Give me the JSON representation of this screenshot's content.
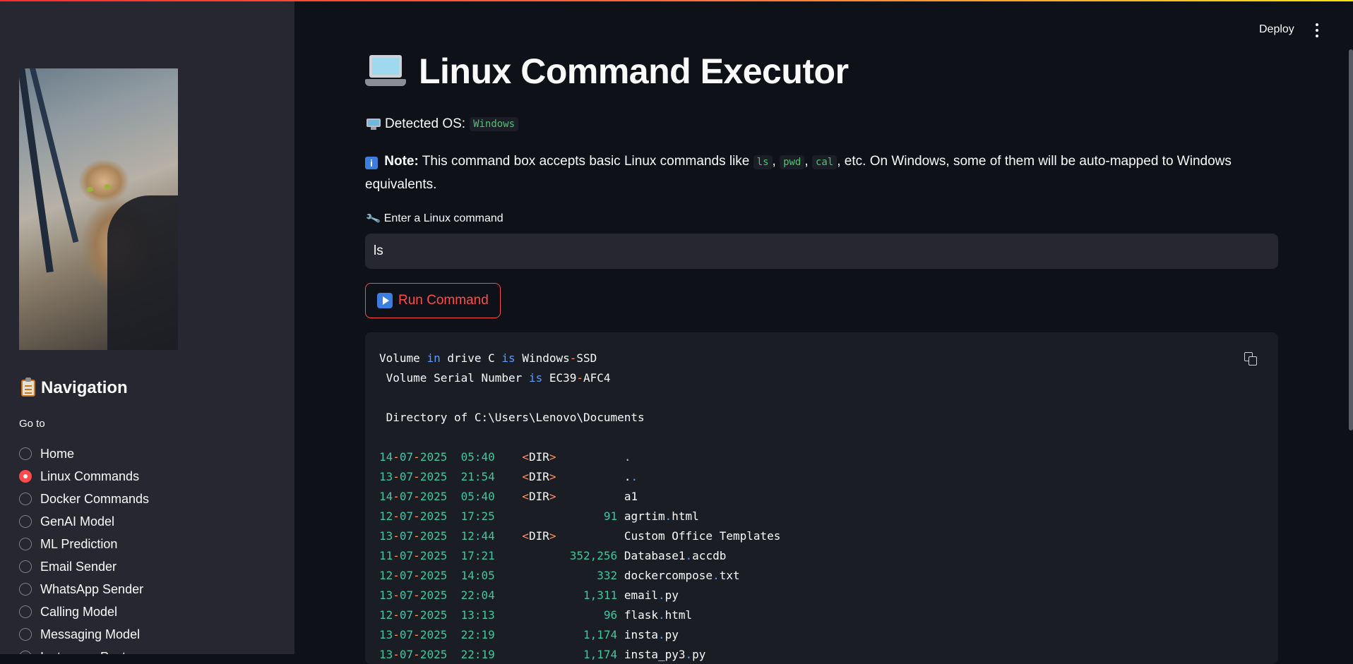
{
  "header": {
    "deploy_label": "Deploy"
  },
  "sidebar": {
    "nav_title": "Navigation",
    "goto_label": "Go to",
    "options": [
      "Home",
      "Linux Commands",
      "Docker Commands",
      "GenAI Model",
      "ML Prediction",
      "Email Sender",
      "WhatsApp Sender",
      "Calling Model",
      "Messaging Model",
      "Instagram Post"
    ],
    "selected": "Linux Commands"
  },
  "main": {
    "title": "Linux Command Executor",
    "os_label": "Detected OS:",
    "os_value": "Windows",
    "note_label": "Note:",
    "note_text_1": "This command box accepts basic Linux commands like",
    "note_cmd_1": "ls",
    "note_cmd_2": "pwd",
    "note_cmd_3": "cal",
    "note_text_2": ", etc. On Windows, some of them will be auto-mapped to Windows equivalents.",
    "input_label": "Enter a Linux command",
    "input_value": "ls",
    "run_label": "Run Command"
  },
  "output": {
    "volume_line": {
      "w1": "Volume",
      "w2": "in",
      "w3": "drive C",
      "w4": "is",
      "w5": "Windows",
      "w6": "-",
      "w7": "SSD"
    },
    "serial_line": {
      "w1": " Volume Serial Number",
      "w2": "is",
      "w3": "EC39",
      "w4": "-",
      "w5": "AFC4"
    },
    "directory_line": " Directory of C:\\Users\\Lenovo\\Documents",
    "rows": [
      {
        "date": "14-07-2025",
        "time": "05:40",
        "dir": true,
        "size": "",
        "name": "."
      },
      {
        "date": "13-07-2025",
        "time": "21:54",
        "dir": true,
        "size": "",
        "name": ".."
      },
      {
        "date": "14-07-2025",
        "time": "05:40",
        "dir": true,
        "size": "",
        "name": "a1"
      },
      {
        "date": "12-07-2025",
        "time": "17:25",
        "dir": false,
        "size": "91",
        "name": "agrtim.html"
      },
      {
        "date": "13-07-2025",
        "time": "12:44",
        "dir": true,
        "size": "",
        "name": "Custom Office Templates"
      },
      {
        "date": "11-07-2025",
        "time": "17:21",
        "dir": false,
        "size": "352,256",
        "name": "Database1.accdb"
      },
      {
        "date": "12-07-2025",
        "time": "14:05",
        "dir": false,
        "size": "332",
        "name": "dockercompose.txt"
      },
      {
        "date": "13-07-2025",
        "time": "22:04",
        "dir": false,
        "size": "1,311",
        "name": "email.py"
      },
      {
        "date": "12-07-2025",
        "time": "13:13",
        "dir": false,
        "size": "96",
        "name": "flask.html"
      },
      {
        "date": "13-07-2025",
        "time": "22:19",
        "dir": false,
        "size": "1,174",
        "name": "insta.py"
      },
      {
        "date": "13-07-2025",
        "time": "22:19",
        "dir": false,
        "size": "1,174",
        "name": "insta_py3.py"
      }
    ]
  },
  "colors": {
    "accent": "#ff4b4b",
    "background": "#0e1117",
    "sidebar": "#262730",
    "keyword": "#5a9cf8",
    "number": "#40c5a6",
    "operator": "#ff8f5e"
  }
}
